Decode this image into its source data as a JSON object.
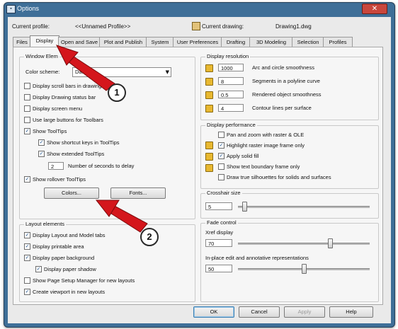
{
  "window": {
    "title": "Options",
    "app_icon": "options-window-icon",
    "close_glyph": "✕"
  },
  "profile": {
    "label": "Current profile:",
    "value": "<<Unnamed Profile>>",
    "drawing_label": "Current drawing:",
    "drawing_value": "Drawing1.dwg"
  },
  "tabs": [
    {
      "label": "Files"
    },
    {
      "label": "Display",
      "active": true
    },
    {
      "label": "Open and Save"
    },
    {
      "label": "Plot and Publish"
    },
    {
      "label": "System"
    },
    {
      "label": "User Preferences"
    },
    {
      "label": "Drafting"
    },
    {
      "label": "3D Modeling"
    },
    {
      "label": "Selection"
    },
    {
      "label": "Profiles"
    }
  ],
  "window_elements": {
    "title": "Window Elem",
    "color_scheme_label": "Color scheme:",
    "color_scheme_value": "Dark",
    "checkboxes": [
      {
        "label": "Display scroll bars in drawing window",
        "checked": false
      },
      {
        "label": "Display Drawing status bar",
        "checked": false
      },
      {
        "label": "Display screen menu",
        "checked": false
      },
      {
        "label": "Use large buttons for Toolbars",
        "checked": false
      },
      {
        "label": "Show ToolTips",
        "checked": true
      },
      {
        "label": "Show shortcut keys in ToolTips",
        "checked": true
      },
      {
        "label": "Show extended ToolTips",
        "checked": true
      },
      {
        "label": "Show rollover ToolTips",
        "checked": true
      }
    ],
    "delay_value": "2",
    "delay_label": "Number of seconds to delay",
    "colors_button": "Colors...",
    "fonts_button": "Fonts..."
  },
  "layout_elements": {
    "title": "Layout elements",
    "checkboxes": [
      {
        "label": "Display Layout and Model tabs",
        "checked": true
      },
      {
        "label": "Display printable area",
        "checked": true
      },
      {
        "label": "Display paper background",
        "checked": true
      },
      {
        "label": "Display paper shadow",
        "checked": true
      },
      {
        "label": "Show Page Setup Manager for new layouts",
        "checked": false
      },
      {
        "label": "Create viewport in new layouts",
        "checked": true
      }
    ]
  },
  "display_resolution": {
    "title": "Display resolution",
    "rows": [
      {
        "value": "1000",
        "label": "Arc and circle smoothness"
      },
      {
        "value": "8",
        "label": "Segments in a polyline curve"
      },
      {
        "value": "0.5",
        "label": "Rendered object smoothness"
      },
      {
        "value": "4",
        "label": "Contour lines per surface"
      }
    ]
  },
  "display_performance": {
    "title": "Display performance",
    "checkboxes": [
      {
        "label": "Pan and zoom with raster & OLE",
        "checked": false
      },
      {
        "label": "Highlight raster image frame only",
        "checked": true
      },
      {
        "label": "Apply solid fill",
        "checked": true
      },
      {
        "label": "Show text boundary frame only",
        "checked": false
      },
      {
        "label": "Draw true silhouettes for solids and surfaces",
        "checked": false
      }
    ]
  },
  "crosshair": {
    "title": "Crosshair size",
    "value": "5",
    "level_percent": 5
  },
  "fade_control": {
    "title": "Fade control",
    "xref_label": "Xref display",
    "xref_value": "70",
    "xref_level_percent": 70,
    "inplace_label": "In-place edit and annotative representations",
    "inplace_value": "50",
    "inplace_level_percent": 50
  },
  "buttons": {
    "ok": "OK",
    "cancel": "Cancel",
    "apply": "Apply",
    "help": "Help"
  },
  "annotations": {
    "callout_1": "1",
    "callout_2": "2",
    "arrow_color": "#d4161c"
  },
  "colors": {
    "window_frame": "#3f6f98",
    "close_button": "#c9473d",
    "panel": "#f6f6f6"
  }
}
